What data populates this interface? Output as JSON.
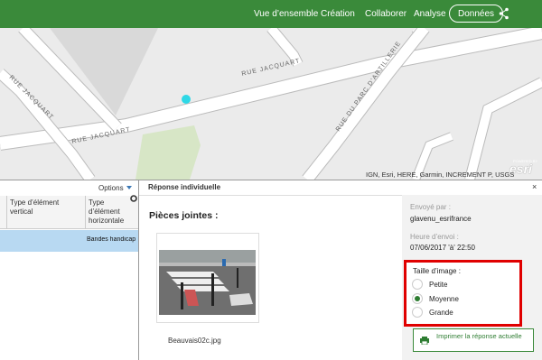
{
  "nav": {
    "items": [
      "Vue d’ensemble",
      "Création",
      "Collaborer",
      "Analyse"
    ],
    "active_button": "Données",
    "share_icon": "share-icon"
  },
  "map": {
    "street_labels": [
      "RUE JACQUART",
      "RUE JACQUART",
      "RUE JACQUART",
      "RUE DU PARC D’ARTILLERIE"
    ],
    "attribution": "IGN, Esri, HERE, Garmin, INCREMENT P, USGS",
    "logo": "esri",
    "logo_tagline": "POWERED BY",
    "colors": {
      "background": "#ebebeb",
      "park": "#d7e6c6",
      "point": "#2ed8e6"
    }
  },
  "table": {
    "options_label": "Options",
    "col1_header": "Type d’élément vertical",
    "col2_header": "Type d’élément horizontale",
    "row_value": "Bandes handicap"
  },
  "panel": {
    "title": "Réponse individuelle",
    "close_label": "×",
    "attachments_title": "Pièces jointes :",
    "attachment_caption": "Beauvais02c.jpg",
    "sent_by_label": "Envoyé par :",
    "sent_by_value": "glavenu_esrifrance",
    "sent_time_label": "Heure d’envoi :",
    "sent_time_value": "07/06/2017 'à' 22:50",
    "image_size_label": "Taille d’image :",
    "size_options": [
      "Petite",
      "Moyenne",
      "Grande"
    ],
    "selected_size": "Moyenne",
    "print_label": "Imprimer la réponse actuelle"
  },
  "colors": {
    "header_green": "#3a8a3a",
    "highlight": "#e00000",
    "selected_row": "#b8d9f2"
  }
}
